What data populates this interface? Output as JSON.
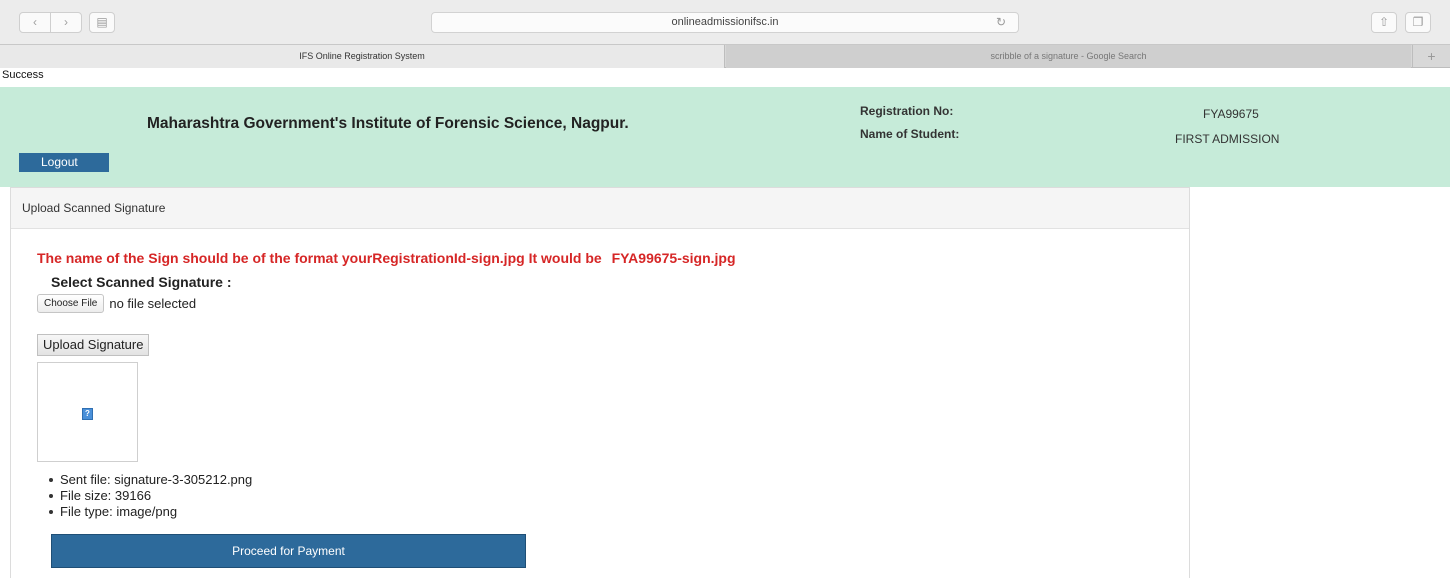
{
  "browser": {
    "url": "onlineadmissionifsc.in",
    "nav_back_icon": "chevron-left-icon",
    "nav_forward_icon": "chevron-right-icon",
    "sidebar_icon": "sidebar-icon",
    "reload_icon": "reload-icon",
    "share_icon": "share-icon",
    "tabs_icon": "tabs-overview-icon",
    "tabs": [
      {
        "label": "IFS Online Registration System",
        "active": true
      },
      {
        "label": "scribble of a signature - Google Search",
        "active": false
      }
    ],
    "new_tab_label": "+"
  },
  "page": {
    "status": "Success",
    "header": {
      "institute": "Maharashtra Government's Institute of Forensic Science, Nagpur.",
      "logout_label": "Logout",
      "registration_label": "Registration No:",
      "registration_value": "FYA99675",
      "student_label": "Name of Student:",
      "student_value": "FIRST ADMISSION",
      "background": "#c6ebd9"
    },
    "panel": {
      "title": "Upload Scanned Signature",
      "instruction": "The name of the Sign should be of the format yourRegistrationId-sign.jpg It would be",
      "example_filename": "FYA99675-sign.jpg",
      "select_label": "Select Scanned Signature :",
      "choose_file_label": "Choose File",
      "file_status": "no file selected",
      "upload_label": "Upload Signature",
      "file_info": [
        "Sent file: signature-3-305212.png",
        "File size: 39166",
        "File type: image/png"
      ],
      "proceed_label": "Proceed for Payment",
      "accent_color": "#2d6a9b",
      "warning_color": "#d62626"
    }
  }
}
